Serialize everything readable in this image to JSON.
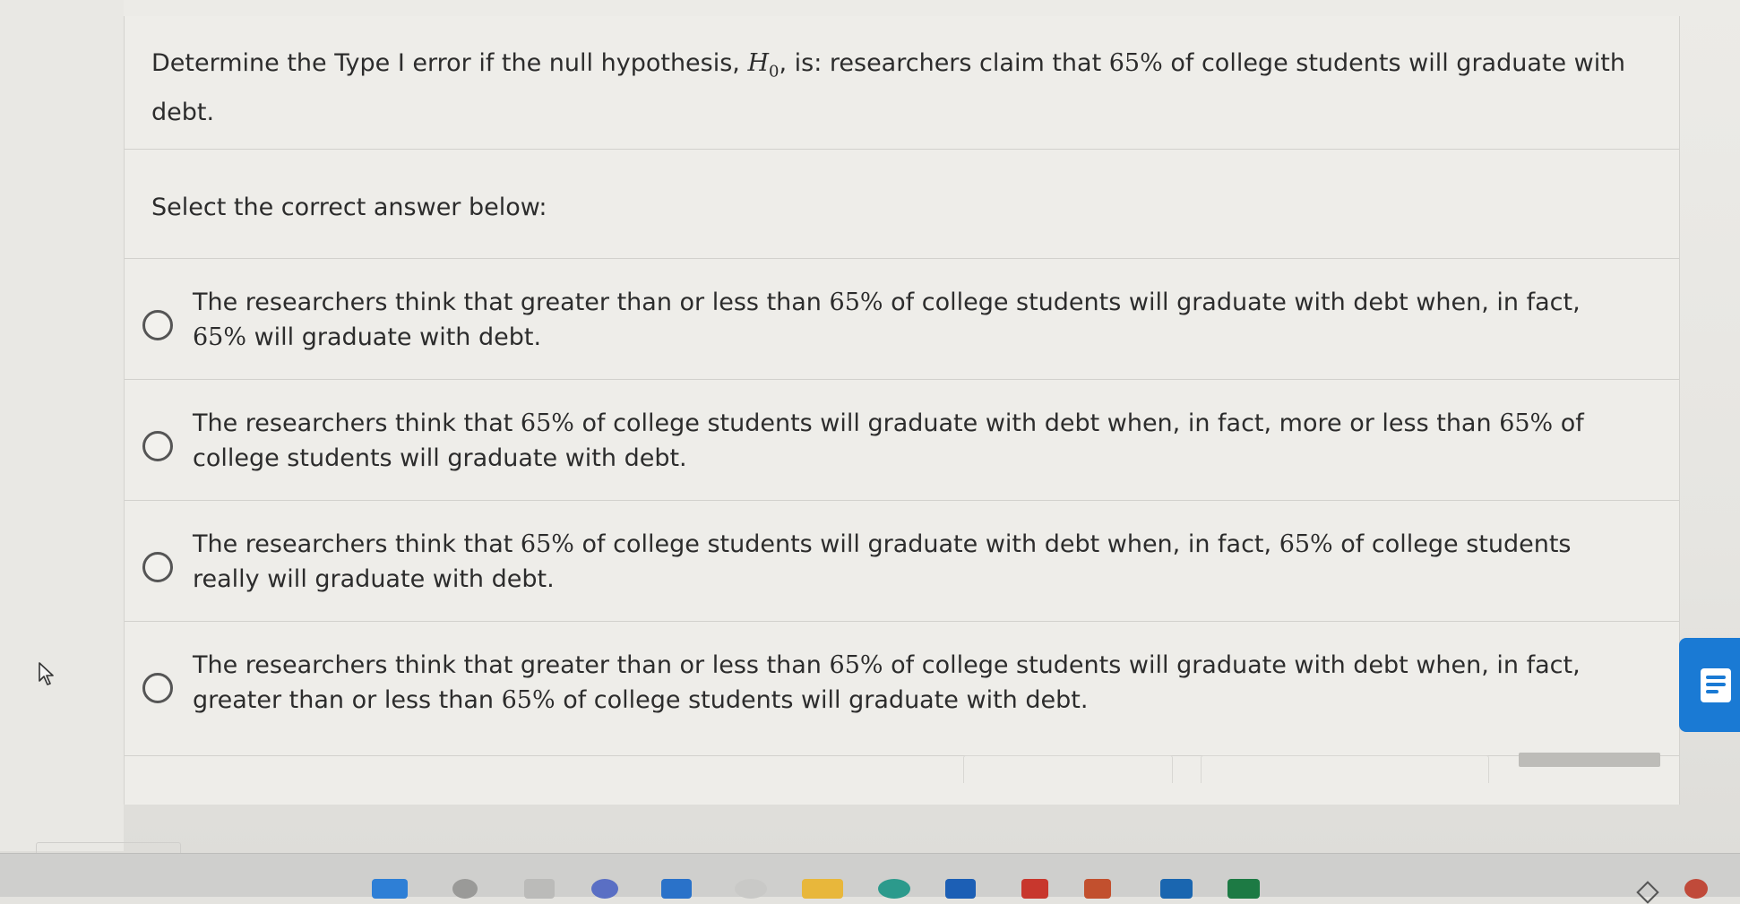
{
  "question": {
    "prefix": "Determine the Type I error if the null hypothesis, ",
    "symbol": "H",
    "symbol_sub": "0",
    "middle": ", is: researchers claim that ",
    "percent": "65%",
    "suffix": " of college students will graduate with debt."
  },
  "instructions": "Select the correct answer below:",
  "options": [
    {
      "parts": [
        "The researchers think that greater than or less than ",
        "65%",
        " of college students will graduate with debt when, in fact, ",
        "65%",
        " will graduate with debt."
      ]
    },
    {
      "parts": [
        "The researchers think that ",
        "65%",
        " of college students will graduate with debt when, in fact, more or less than ",
        "65%",
        " of college students will graduate with debt."
      ]
    },
    {
      "parts": [
        "The researchers think that ",
        "65%",
        " of college students will graduate with debt when, in fact, ",
        "65%",
        " of college students really will graduate with debt."
      ]
    },
    {
      "parts": [
        "The researchers think that greater than or less than ",
        "65%",
        " of college students will graduate with debt when, in fact, greater than or less than ",
        "65%",
        " of college students will graduate with debt."
      ]
    }
  ],
  "colors": {
    "accent": "#1a7ad4",
    "background": "#eeede9",
    "text": "#2c2c2c"
  },
  "icons": {
    "cursor": "mouse-pointer-icon",
    "side_panel": "chat-lines-icon",
    "radio": "radio-unselected-icon"
  }
}
